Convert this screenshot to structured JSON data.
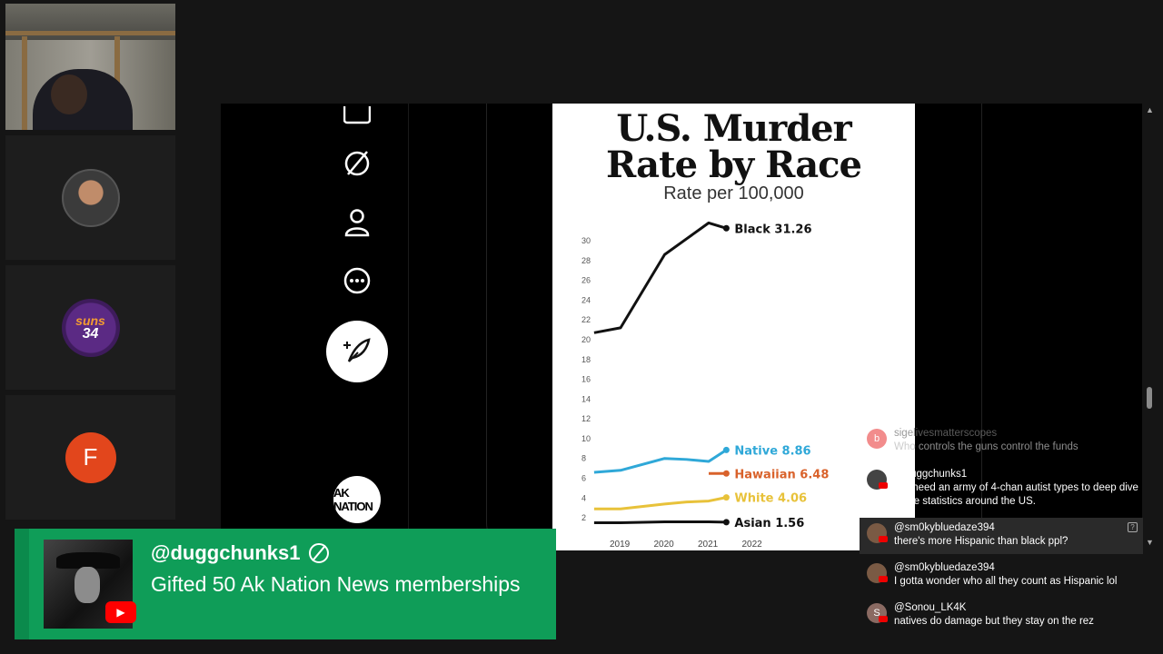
{
  "participants": {
    "tile1": "camera",
    "tile3": {
      "lines": [
        "suns",
        "34"
      ]
    },
    "tile4": {
      "letter": "F"
    }
  },
  "nav": {
    "icons": [
      "message-square-icon",
      "no-phone-icon",
      "profile-icon",
      "more-dots-icon"
    ],
    "compose_icon": "feather-plus-icon",
    "logo_text": "AK NATION"
  },
  "chart_data": {
    "type": "line",
    "title_line1": "U.S. Murder",
    "title_line2": "Rate by Race",
    "subtitle": "Rate per 100,000",
    "x_ticks": [
      "2019",
      "2020",
      "2021",
      "2022"
    ],
    "y_ticks": [
      "2",
      "4",
      "6",
      "8",
      "10",
      "12",
      "14",
      "16",
      "18",
      "20",
      "22",
      "24",
      "26",
      "28",
      "30"
    ],
    "ylim": [
      0,
      31
    ],
    "series": [
      {
        "name": "Black",
        "label": "Black 31.26",
        "color": "#111111",
        "x": [
          2018.4,
          2019.0,
          2020.0,
          2020.5,
          2021.0,
          2021.4
        ],
        "y": [
          20.7,
          21.2,
          28.6,
          30.2,
          31.8,
          31.26
        ]
      },
      {
        "name": "Native",
        "label": "Native 8.86",
        "color": "#2fa8d8",
        "x": [
          2018.4,
          2019.0,
          2020.0,
          2020.5,
          2021.0,
          2021.4
        ],
        "y": [
          6.6,
          6.8,
          8.0,
          7.9,
          7.7,
          8.86
        ]
      },
      {
        "name": "Hawaiian",
        "label": "Hawaiian 6.48",
        "color": "#d9622b",
        "x": [
          2021.0,
          2021.4
        ],
        "y": [
          6.48,
          6.48
        ]
      },
      {
        "name": "White",
        "label": "White 4.06",
        "color": "#e8c23a",
        "x": [
          2018.4,
          2019.0,
          2020.0,
          2020.5,
          2021.0,
          2021.4
        ],
        "y": [
          2.9,
          2.9,
          3.4,
          3.6,
          3.7,
          4.06
        ]
      },
      {
        "name": "Asian",
        "label": "Asian 1.56",
        "color": "#111111",
        "x": [
          2018.4,
          2019.0,
          2020.0,
          2020.5,
          2021.0,
          2021.4
        ],
        "y": [
          1.5,
          1.5,
          1.6,
          1.6,
          1.6,
          1.56
        ]
      }
    ],
    "grid": false,
    "legend": "end-of-line labels"
  },
  "chat": {
    "messages": [
      {
        "name": "sigelivesmatterscopes",
        "text": "Who controls the guns control the funds",
        "avatar_letter": "b"
      },
      {
        "name": "@duggchunks1",
        "text": "We need an army of 4-chan autist types to deep dive crime statistics around the US."
      },
      {
        "name": "@sm0kybluedaze394",
        "text": "there's more Hispanic than black ppl?"
      },
      {
        "name": "@sm0kybluedaze394",
        "text": "I gotta wonder who all they count as Hispanic lol"
      },
      {
        "name": "@Sonou_LK4K",
        "text": "natives do damage but they stay on the rez",
        "avatar_letter": "S"
      }
    ]
  },
  "banner": {
    "username": "@duggchunks1",
    "message": "Gifted 50 Ak Nation News memberships",
    "color": "#0f9d58"
  }
}
